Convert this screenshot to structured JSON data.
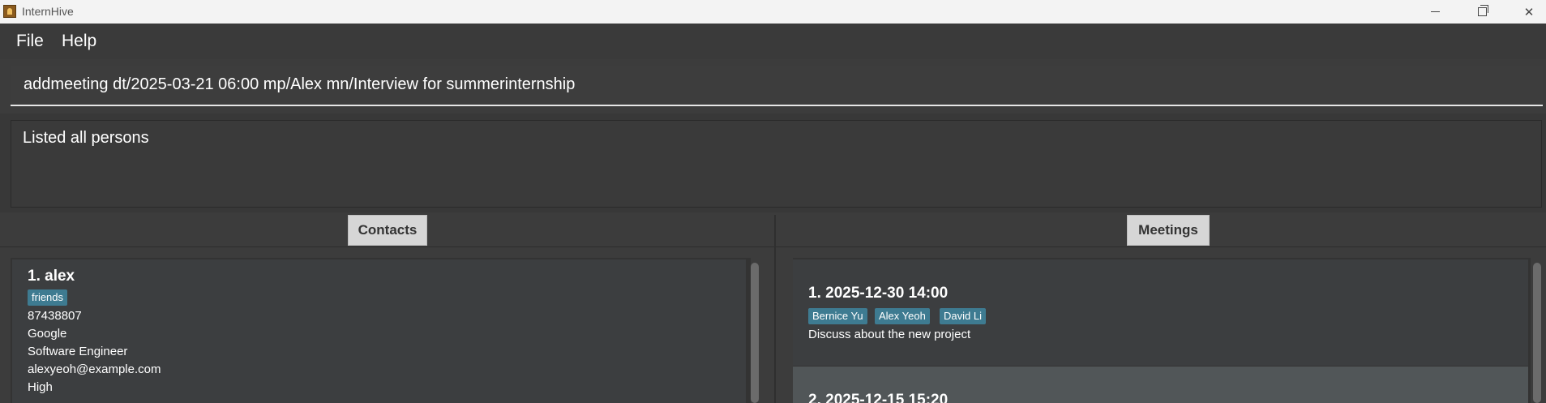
{
  "window": {
    "title": "InternHive",
    "icon": "app-icon"
  },
  "menu": {
    "file": "File",
    "help": "Help"
  },
  "command": {
    "value": "addmeeting dt/2025-03-21 06:00 mp/Alex mn/Interview for summerinternship"
  },
  "result": {
    "text": "Listed all persons"
  },
  "contacts": {
    "header": "Contacts",
    "items": [
      {
        "title": "1.  alex",
        "tag": "friends",
        "phone": "87438807",
        "company": "Google",
        "role": "Software Engineer",
        "email": "alexyeoh@example.com",
        "priority": "High"
      }
    ]
  },
  "meetings": {
    "header": "Meetings",
    "items": [
      {
        "title": "1.  2025-12-30 14:00",
        "tags": [
          "Bernice Yu",
          "Alex Yeoh",
          "David Li"
        ],
        "description": "Discuss about the new project"
      },
      {
        "title": "2.  2025-12-15 15:20"
      }
    ]
  },
  "colors": {
    "tag": "#3e7b91",
    "background": "#3c3c3c",
    "selected_card": "#515658"
  }
}
